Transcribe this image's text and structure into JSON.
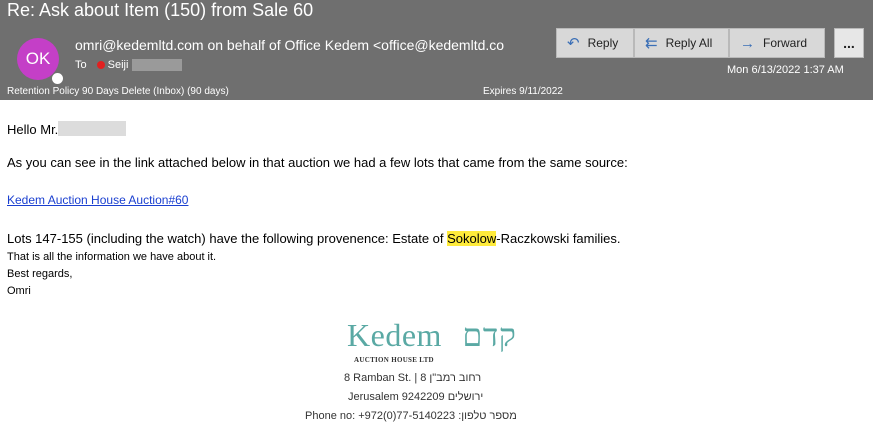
{
  "header": {
    "subject": "Re: Ask about Item (150) from Sale 60",
    "avatar_initials": "OK",
    "avatar_color": "#c43fc7",
    "from": "omri@kedemltd.com on behalf of Office Kedem <office@kedemltd.co",
    "to_label": "To",
    "to_name": "Seiji",
    "date": "Mon 6/13/2022 1:37 AM",
    "retention": "Retention Policy   90 Days Delete (Inbox) (90 days)",
    "expires": "Expires   9/11/2022"
  },
  "actions": {
    "reply": "Reply",
    "reply_all": "Reply All",
    "forward": "Forward",
    "more": "..."
  },
  "body": {
    "greeting": "Hello Mr.",
    "line1": "As you can see in the link attached below in that auction we had a few lots that came from the same source:",
    "link_text": "Kedem Auction House Auction#60",
    "provenance_before": "Lots 147-155 (including the watch) have the following provenence: Estate of ",
    "provenance_highlight": "Sokolow",
    "provenance_after": "-Raczkowski families.",
    "line3": "That is all the information we have about it.",
    "line4": "Best regards,",
    "line5": "Omri"
  },
  "signature": {
    "logo_latin": "Kedem",
    "logo_hebrew": "קדם",
    "logo_sub": "AUCTION HOUSE LTD",
    "address1": "8 Ramban St.   |   רחוב רמב\"ן 8",
    "address2": "Jerusalem   9242209   ירושלים",
    "phone": "Phone no:  +972(0)77-5140223  :מספר טלפון"
  }
}
